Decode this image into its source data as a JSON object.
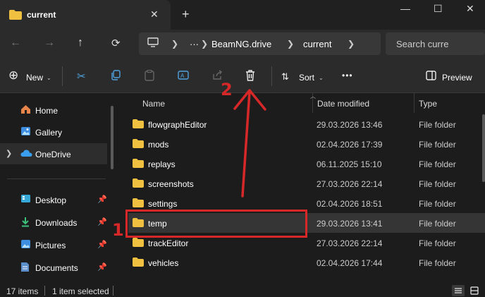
{
  "tab": {
    "title": "current",
    "close": "✕",
    "new_tab": "+"
  },
  "window_controls": {
    "minimize": "—",
    "maximize": "☐",
    "close": "✕"
  },
  "nav": {
    "back": "←",
    "forward": "→",
    "up": "↑",
    "breadcrumb": [
      "BeamNG.drive",
      "current"
    ],
    "more": "···",
    "search_placeholder": "Search curre"
  },
  "commands": {
    "new_label": "New",
    "sort_label": "Sort",
    "preview_label": "Preview",
    "more": "•••"
  },
  "sidebar": {
    "items": [
      {
        "label": "Home",
        "icon": "home-icon"
      },
      {
        "label": "Gallery",
        "icon": "gallery-icon"
      },
      {
        "label": "OneDrive",
        "icon": "cloud-icon"
      },
      {
        "label": "Desktop",
        "icon": "desktop-icon"
      },
      {
        "label": "Downloads",
        "icon": "download-icon"
      },
      {
        "label": "Pictures",
        "icon": "pictures-icon"
      },
      {
        "label": "Documents",
        "icon": "documents-icon"
      }
    ]
  },
  "columns": {
    "name": "Name",
    "date": "Date modified",
    "type": "Type"
  },
  "files": [
    {
      "name": "flowgraphEditor",
      "date": "29.03.2026 13:46",
      "type": "File folder"
    },
    {
      "name": "mods",
      "date": "02.04.2026 17:39",
      "type": "File folder"
    },
    {
      "name": "replays",
      "date": "06.11.2025 15:10",
      "type": "File folder"
    },
    {
      "name": "screenshots",
      "date": "27.03.2026 22:14",
      "type": "File folder"
    },
    {
      "name": "settings",
      "date": "02.04.2026 18:51",
      "type": "File folder"
    },
    {
      "name": "temp",
      "date": "29.03.2026 13:41",
      "type": "File folder"
    },
    {
      "name": "trackEditor",
      "date": "27.03.2026 22:14",
      "type": "File folder"
    },
    {
      "name": "vehicles",
      "date": "02.04.2026 17:44",
      "type": "File folder"
    }
  ],
  "status": {
    "item_count": "17 items",
    "selected": "1 item selected"
  },
  "annotations": {
    "step1": "1",
    "step2": "2",
    "color": "#d62828"
  },
  "colors": {
    "accent": "#4fa3e0",
    "folder": "#f0c040",
    "annotation": "#d62828"
  }
}
